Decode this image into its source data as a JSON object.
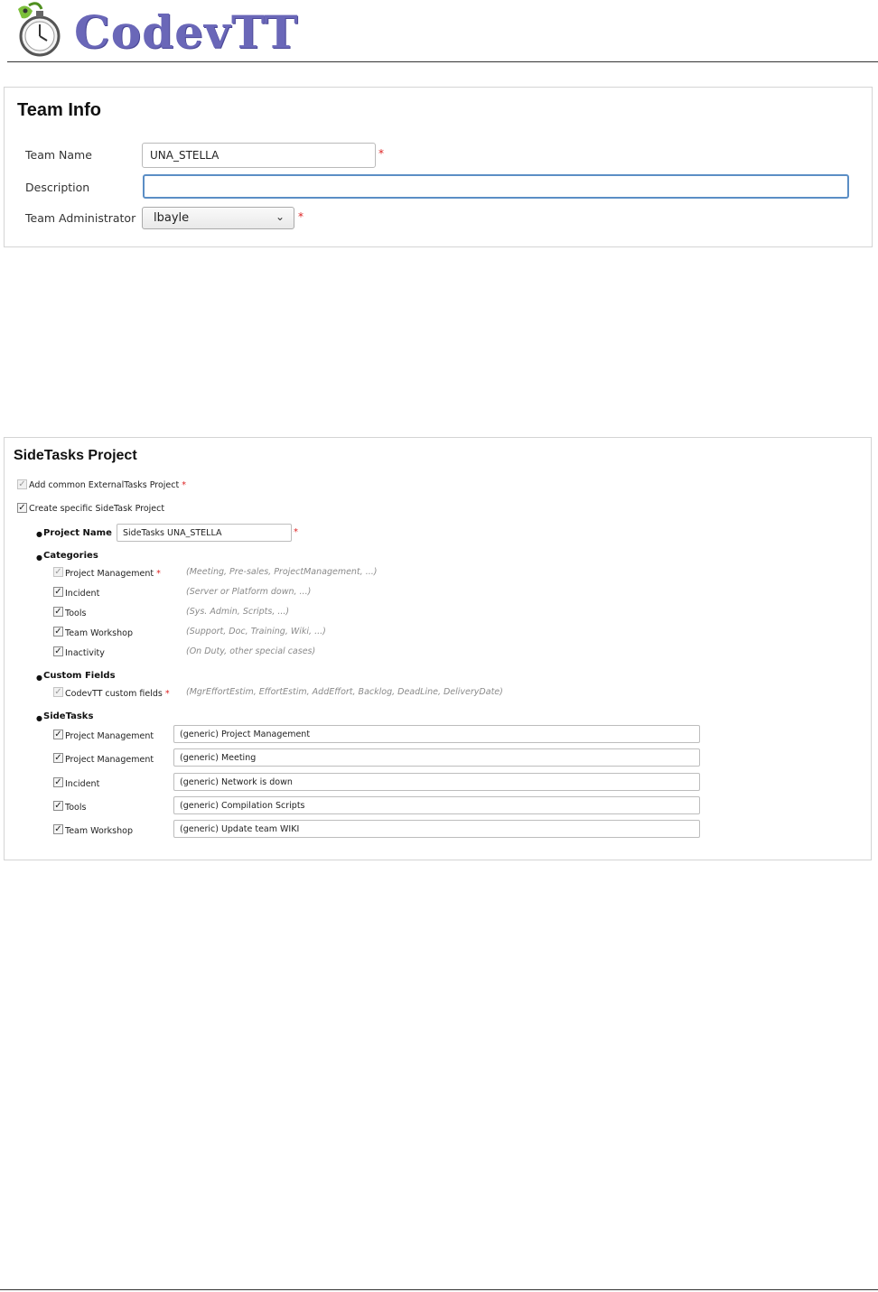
{
  "header": {
    "app_name": "CodevTT"
  },
  "team_info": {
    "title": "Team Info",
    "team_name_label": "Team Name",
    "team_name_value": "UNA_STELLA",
    "description_label": "Description",
    "description_value": "",
    "admin_label": "Team Administrator",
    "admin_value": "lbayle",
    "required_mark": "*"
  },
  "sidetasks": {
    "title": "SideTasks Project",
    "add_common_label": "Add common ExternalTasks Project",
    "create_specific_label": "Create specific SideTask Project",
    "project_name_label": "Project Name",
    "project_name_value": "SideTasks UNA_STELLA",
    "categories_label": "Categories",
    "categories": [
      {
        "label": "Project Management",
        "hint": "(Meeting, Pre-sales, ProjectManagement, ...)"
      },
      {
        "label": "Incident",
        "hint": "(Server or Platform down, ...)"
      },
      {
        "label": "Tools",
        "hint": "(Sys. Admin, Scripts, ...)"
      },
      {
        "label": "Team Workshop",
        "hint": "(Support, Doc, Training, Wiki, ...)"
      },
      {
        "label": "Inactivity",
        "hint": "(On Duty, other special cases)"
      }
    ],
    "custom_fields_label": "Custom Fields",
    "custom_fields_item": "CodevTT custom fields",
    "custom_fields_hint": "(MgrEffortEstim, EffortEstim, AddEffort, Backlog, DeadLine, DeliveryDate)",
    "sidetasks_label": "SideTasks",
    "tasks": [
      {
        "label": "Project Management",
        "value": "(generic) Project Management"
      },
      {
        "label": "Project Management",
        "value": "(generic) Meeting"
      },
      {
        "label": "Incident",
        "value": "(generic) Network is down"
      },
      {
        "label": "Tools",
        "value": "(generic) Compilation Scripts"
      },
      {
        "label": "Team Workshop",
        "value": "(generic) Update team WIKI"
      }
    ]
  }
}
